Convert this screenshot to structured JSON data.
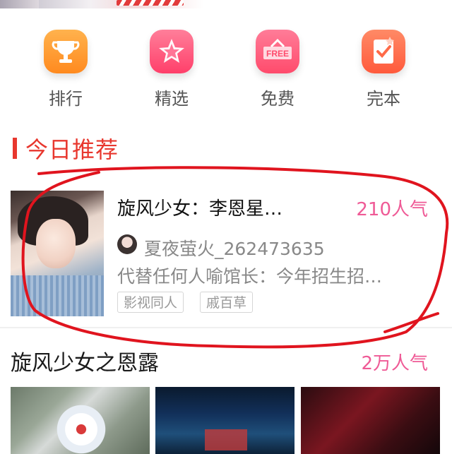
{
  "categories": [
    {
      "label": "排行",
      "icon": "trophy-icon"
    },
    {
      "label": "精选",
      "icon": "star-icon"
    },
    {
      "label": "免费",
      "icon": "free-tag-icon",
      "badge": "FREE"
    },
    {
      "label": "完本",
      "icon": "checkmark-book-icon"
    }
  ],
  "section": {
    "title": "今日推荐"
  },
  "featured": {
    "title": "旋风少女：李恩星…",
    "popularity": "210人气",
    "author": "夏夜萤火_262473635",
    "excerpt": "代替任何人喻馆长：今年招生招…",
    "tags": [
      "影视同人",
      "戚百草"
    ]
  },
  "list": {
    "title": "旋风少女之恩露",
    "popularity": "2万人气"
  },
  "colors": {
    "accent_red": "#e8372e",
    "popularity_pink": "#ef5a96",
    "annotation_red": "#e0141e"
  }
}
